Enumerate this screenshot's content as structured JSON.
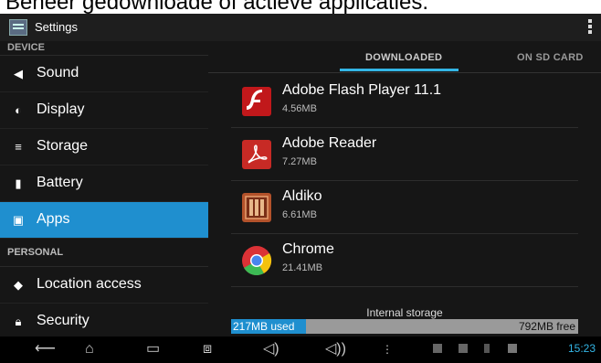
{
  "caption": "Beheer gedownloade of actieve applicaties.",
  "header": {
    "title": "Settings"
  },
  "sidebar": {
    "sections": [
      {
        "label": "DEVICE"
      },
      {
        "label": "PERSONAL"
      }
    ],
    "items": [
      {
        "label": "Sound",
        "icon": "speaker-icon"
      },
      {
        "label": "Display",
        "icon": "brightness-icon"
      },
      {
        "label": "Storage",
        "icon": "storage-icon"
      },
      {
        "label": "Battery",
        "icon": "battery-icon"
      },
      {
        "label": "Apps",
        "icon": "apps-icon",
        "selected": true
      },
      {
        "label": "Location access",
        "icon": "location-icon"
      },
      {
        "label": "Security",
        "icon": "lock-icon"
      }
    ]
  },
  "tabs": [
    {
      "label": "DOWNLOADED",
      "active": true
    },
    {
      "label": "ON SD CARD",
      "active": false
    }
  ],
  "apps": [
    {
      "name": "Adobe Flash Player 11.1",
      "size": "4.56MB",
      "icon": "flash-icon"
    },
    {
      "name": "Adobe Reader",
      "size": "7.27MB",
      "icon": "adobe-reader-icon"
    },
    {
      "name": "Aldiko",
      "size": "6.61MB",
      "icon": "aldiko-icon"
    },
    {
      "name": "Chrome",
      "size": "21.41MB",
      "icon": "chrome-icon"
    }
  ],
  "storage": {
    "label": "Internal storage",
    "used": "217MB used",
    "free": "792MB free",
    "used_fraction": 0.215
  },
  "status": {
    "time": "15:23"
  },
  "colors": {
    "accent": "#1f8fcf",
    "holo_blue": "#33b5e5"
  }
}
